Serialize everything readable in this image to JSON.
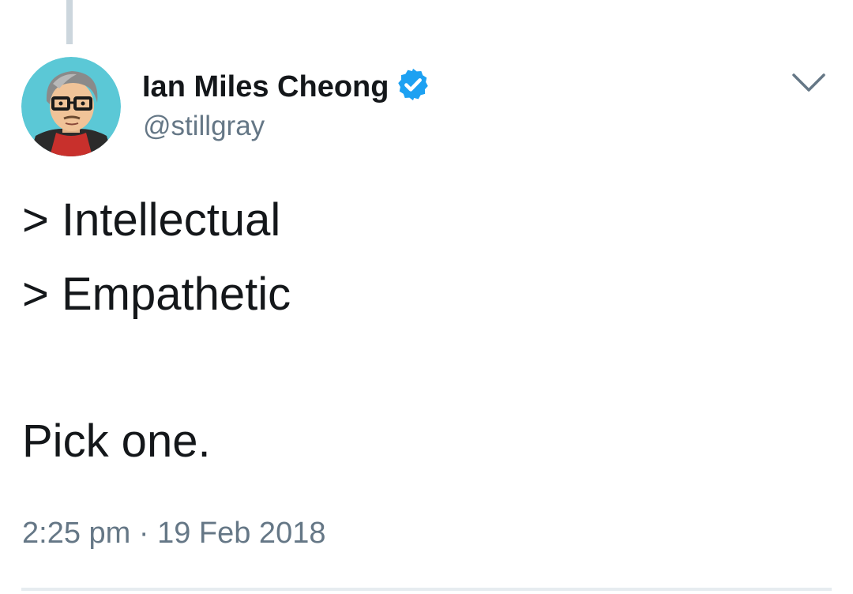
{
  "tweet": {
    "author": {
      "display_name": "Ian Miles Cheong",
      "handle": "@stillgray",
      "verified": true,
      "avatar_icon": "cartoon-avatar"
    },
    "lines": [
      "> Intellectual",
      "> Empathetic",
      "Pick one."
    ],
    "timestamp": "2:25 pm · 19 Feb 2018"
  },
  "icons": {
    "verified": "verified-badge-icon",
    "menu": "chevron-down-icon"
  },
  "colors": {
    "name_text": "#14171a",
    "secondary_text": "#657786",
    "verified_blue": "#1da1f2",
    "thread_line": "#ccd6dd",
    "divider": "#e6ecf0"
  }
}
